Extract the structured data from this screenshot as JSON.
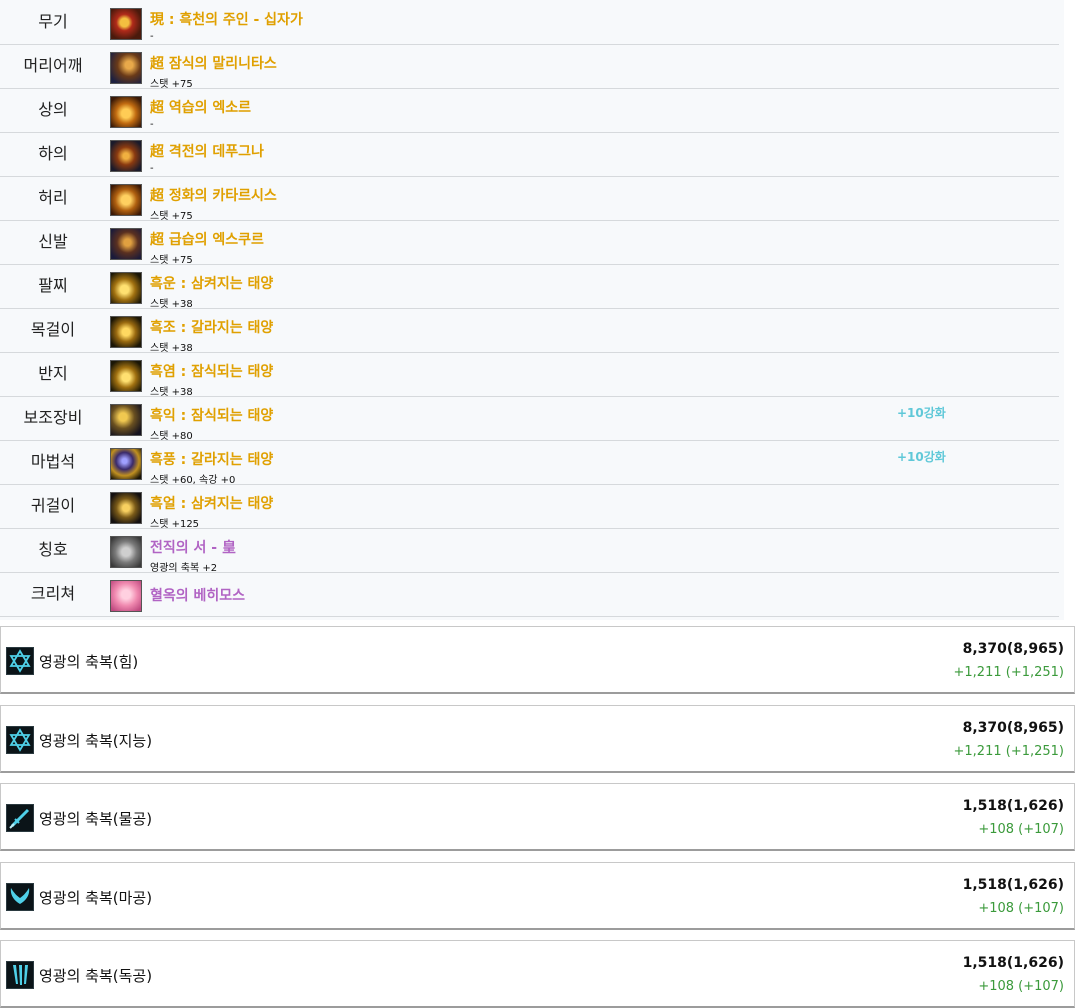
{
  "equipment": [
    {
      "slot": "무기",
      "name": "現 : 흑천의 주인 - 십자가",
      "stat": "-",
      "reinforce": "",
      "rarity": "orange",
      "icon": "cross-weapon-icon"
    },
    {
      "slot": "머리어깨",
      "name": "超 잠식의 말리니타스",
      "stat": "스탯 +75",
      "reinforce": "",
      "rarity": "orange",
      "icon": "shoulder-armor-icon"
    },
    {
      "slot": "상의",
      "name": "超 역습의 엑소르",
      "stat": "-",
      "reinforce": "",
      "rarity": "orange",
      "icon": "top-armor-icon"
    },
    {
      "slot": "하의",
      "name": "超 격전의 데푸그나",
      "stat": "-",
      "reinforce": "",
      "rarity": "orange",
      "icon": "bottom-armor-icon"
    },
    {
      "slot": "허리",
      "name": "超 정화의 카타르시스",
      "stat": "스탯 +75",
      "reinforce": "",
      "rarity": "orange",
      "icon": "belt-icon"
    },
    {
      "slot": "신발",
      "name": "超 급습의 엑스쿠르",
      "stat": "스탯 +75",
      "reinforce": "",
      "rarity": "orange",
      "icon": "shoes-icon"
    },
    {
      "slot": "팔찌",
      "name": "흑운 : 삼켜지는 태양",
      "stat": "스탯 +38",
      "reinforce": "",
      "rarity": "orange",
      "icon": "bracelet-icon"
    },
    {
      "slot": "목걸이",
      "name": "흑조 : 갈라지는 태양",
      "stat": "스탯 +38",
      "reinforce": "",
      "rarity": "orange",
      "icon": "necklace-icon"
    },
    {
      "slot": "반지",
      "name": "흑염 : 잠식되는 태양",
      "stat": "스탯 +38",
      "reinforce": "",
      "rarity": "orange",
      "icon": "ring-icon"
    },
    {
      "slot": "보조장비",
      "name": "흑익 : 잠식되는 태양",
      "stat": "스탯 +80",
      "reinforce": "+10강화",
      "rarity": "orange",
      "icon": "wing-sub-equipment-icon"
    },
    {
      "slot": "마법석",
      "name": "흑풍 : 갈라지는 태양",
      "stat": "스탯 +60, 속강 +0",
      "reinforce": "+10강화",
      "rarity": "orange",
      "icon": "magic-stone-icon"
    },
    {
      "slot": "귀걸이",
      "name": "흑얼 : 삼켜지는 태양",
      "stat": "스탯 +125",
      "reinforce": "",
      "rarity": "orange",
      "icon": "earring-icon"
    },
    {
      "slot": "칭호",
      "name": "전직의 서 - 皇",
      "stat": "영광의 축복 +2",
      "reinforce": "",
      "rarity": "purple",
      "icon": "title-book-icon"
    },
    {
      "slot": "크리쳐",
      "name": "혈옥의 베히모스",
      "stat": "",
      "reinforce": "",
      "rarity": "purple",
      "icon": "creature-pink-icon"
    }
  ],
  "blessings": [
    {
      "name": "영광의 축복(힘)",
      "value": "8,370(8,965)",
      "bonus": "+1,211 (+1,251)",
      "icon": "hexagram-icon"
    },
    {
      "name": "영광의 축복(지능)",
      "value": "8,370(8,965)",
      "bonus": "+1,211 (+1,251)",
      "icon": "hexagram-icon"
    },
    {
      "name": "영광의 축복(물공)",
      "value": "1,518(1,626)",
      "bonus": "+108 (+107)",
      "icon": "sword-icon"
    },
    {
      "name": "영광의 축복(마공)",
      "value": "1,518(1,626)",
      "bonus": "+108 (+107)",
      "icon": "magic-wings-icon"
    },
    {
      "name": "영광의 축복(독공)",
      "value": "1,518(1,626)",
      "bonus": "+108 (+107)",
      "icon": "claw-icon"
    }
  ],
  "colors": {
    "item_orange": "#e0a000",
    "item_purple": "#b164c4",
    "reinforce_cyan": "#5fc8d8",
    "bonus_green": "#3b9a3b",
    "blessing_icon_cyan": "#4fd0e8"
  }
}
